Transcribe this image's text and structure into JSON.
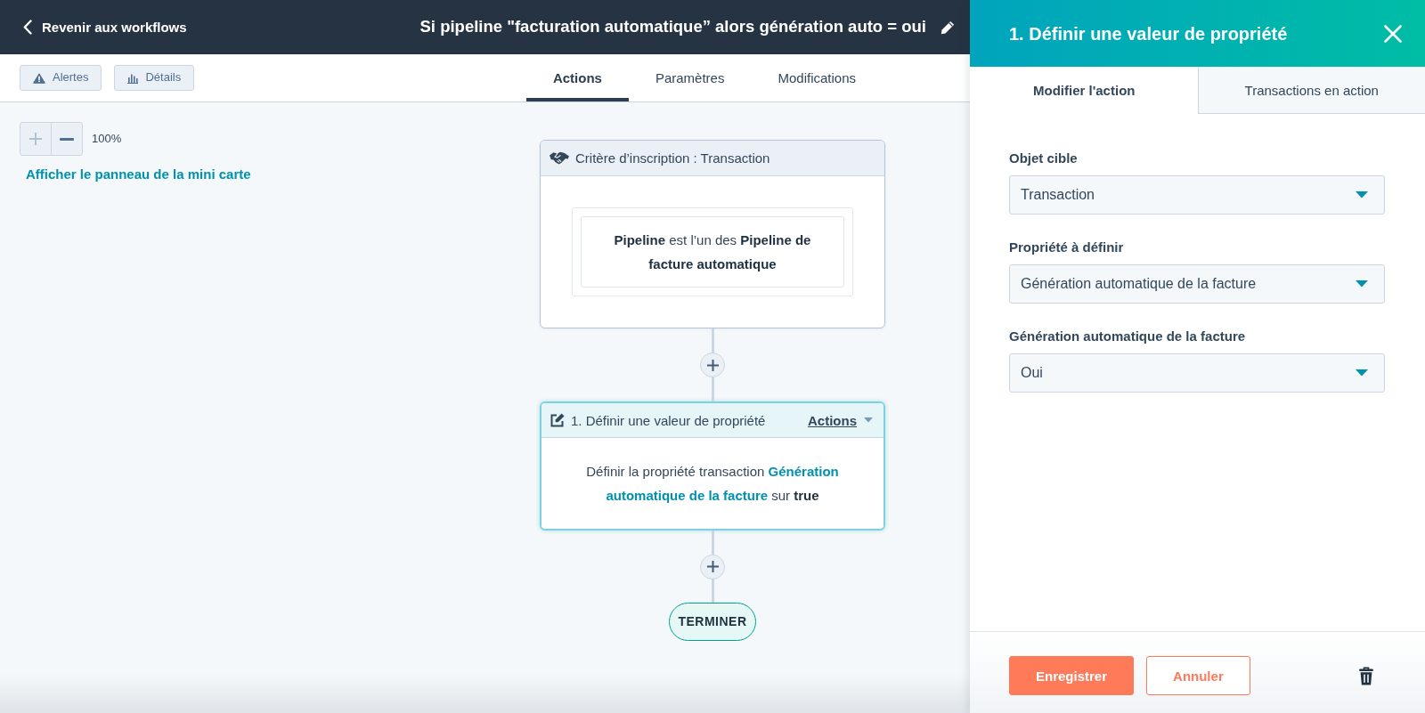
{
  "header": {
    "back_link": "Revenir aux workflows",
    "title": "Si pipeline \"facturation automatique” alors génération auto = oui"
  },
  "toolbar": {
    "buttons": [
      {
        "kind": "alerts",
        "label": "Alertes"
      },
      {
        "kind": "details",
        "label": "Détails"
      }
    ],
    "tabs": [
      {
        "label": "Actions",
        "selected": true
      },
      {
        "label": "Paramètres",
        "selected": false
      },
      {
        "label": "Modifications",
        "selected": false
      }
    ]
  },
  "canvas": {
    "zoom": {
      "controls": [
        {
          "kind": "zoom_in",
          "disabled": true
        },
        {
          "kind": "zoom_out",
          "disabled": false
        }
      ],
      "percentage": "100%"
    },
    "minimap_link": "Afficher le panneau de la mini carte",
    "nodes": [
      {
        "kind": "trigger",
        "selected": false,
        "title": "Critère d’inscription : Transaction",
        "criteria": "**Pipeline** est l’un des **Pipeline de facture automatique**"
      },
      {
        "kind": "action",
        "selected": true,
        "title": "1. Définir une valeur de propriété",
        "menu": "Actions",
        "description": [
          {
            "kind": "text",
            "text": "Définir la propriété transaction "
          },
          {
            "kind": "property",
            "text": "Génération automatique de la facture"
          },
          {
            "kind": "text",
            "text": " sur "
          },
          {
            "kind": "value",
            "text": "true"
          }
        ]
      },
      {
        "kind": "end",
        "selected": false,
        "label": "TERMINER"
      }
    ]
  },
  "panel": {
    "title": "1. Définir une valeur de propriété",
    "tabs": [
      {
        "label": "Modifier l'action",
        "selected": true
      },
      {
        "label": "Transactions en action",
        "selected": false
      }
    ],
    "fields": [
      {
        "label": "Objet cible",
        "value": "Transaction"
      },
      {
        "label": "Propriété à définir",
        "value": "Génération automatique de la facture"
      },
      {
        "label": "Génération automatique de la facture",
        "value": "Oui"
      }
    ],
    "buttons": [
      {
        "kind": "primary",
        "label": "Enregistrer"
      },
      {
        "kind": "secondary",
        "label": "Annuler"
      }
    ]
  }
}
